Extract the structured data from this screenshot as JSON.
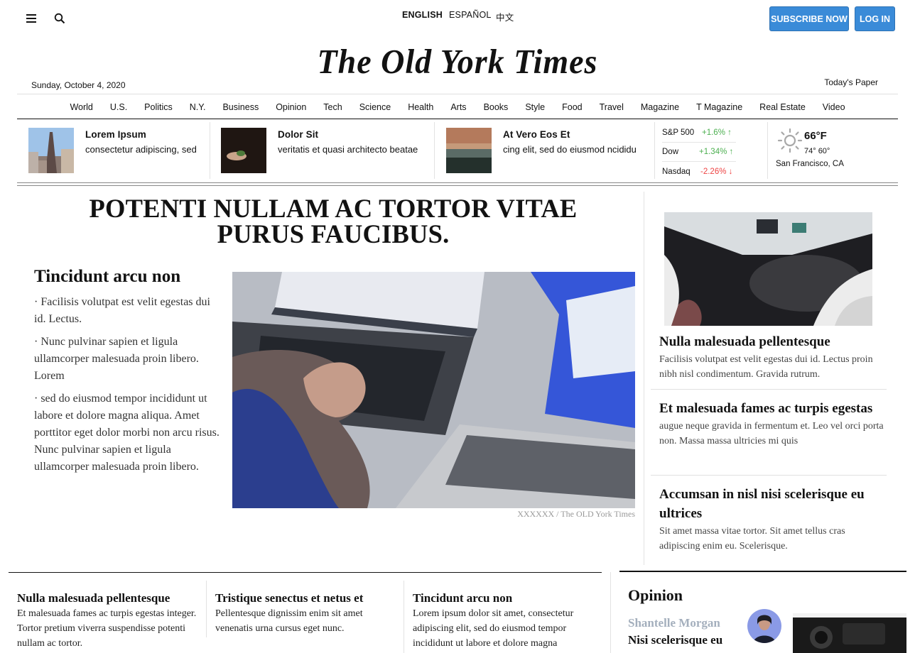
{
  "topbar": {
    "languages": [
      "ENGLISH",
      "ESPAÑOL",
      "中文"
    ],
    "subscribe_label": "SUBSCRIBE NOW",
    "login_label": "LOG IN"
  },
  "masthead": {
    "title": "The Old York Times",
    "date": "Sunday, October 4, 2020",
    "todays_paper": "Today's Paper"
  },
  "nav": [
    "World",
    "U.S.",
    "Politics",
    "N.Y.",
    "Business",
    "Opinion",
    "Tech",
    "Science",
    "Health",
    "Arts",
    "Books",
    "Style",
    "Food",
    "Travel",
    "Magazine",
    "T Magazine",
    "Real Estate",
    "Video"
  ],
  "briefing": [
    {
      "title": "Lorem Ipsum",
      "summary": "consectetur adipiscing, sed"
    },
    {
      "title": "Dolor Sit",
      "summary": "veritatis et quasi architecto beatae"
    },
    {
      "title": "At Vero Eos Et",
      "summary": "cing elit, sed do eiusmod ncididu"
    }
  ],
  "markets": [
    {
      "name": "S&P 500",
      "change": "+1.6%",
      "arrow": "↑",
      "direction": "up"
    },
    {
      "name": "Dow",
      "change": "+1.34%",
      "arrow": "↑",
      "direction": "up"
    },
    {
      "name": "Nasdaq",
      "change": "-2.26%",
      "arrow": "↓",
      "direction": "down"
    }
  ],
  "weather": {
    "temp": "66°F",
    "hilo": "74° 60°",
    "city": "San Francisco, CA"
  },
  "main": {
    "headline_line1": "POTENTI NULLAM AC TORTOR VITAE",
    "headline_line2": "PURUS FAUCIBUS.",
    "subheadline": "Tincidunt arcu non",
    "bullets": [
      "· Facilisis volutpat est velit egestas dui id. Lectus.",
      "· Nunc pulvinar sapien et ligula ullamcorper malesuada proin libero. Lorem",
      "· sed do eiusmod tempor incididunt ut labore et dolore magna aliqua. Amet porttitor eget dolor morbi non arcu risus. Nunc pulvinar sapien et ligula ullamcorper malesuada proin libero."
    ],
    "caption": "XXXXXX / The OLD York Times"
  },
  "right_column": [
    {
      "headline": "Nulla malesuada pellentesque",
      "summary": "Facilisis volutpat est velit egestas dui id. Lectus proin nibh nisl condimentum. Gravida rutrum."
    },
    {
      "headline": "Et malesuada fames ac turpis egestas",
      "summary": "augue neque gravida in fermentum et. Leo vel orci porta non. Massa massa ultricies mi quis"
    },
    {
      "headline": "Accumsan in nisl nisi scelerisque eu ultrices",
      "summary": "Sit amet massa vitae tortor. Sit amet tellus cras adipiscing enim eu. Scelerisque."
    }
  ],
  "bottom_stories": [
    {
      "headline": "Nulla malesuada pellentesque",
      "summary": "Et malesuada fames ac turpis egestas integer. Tortor pretium viverra suspendisse potenti nullam ac tortor."
    },
    {
      "headline": "Tristique senectus et netus et",
      "summary": "Pellentesque dignissim enim sit amet venenatis urna cursus eget nunc."
    },
    {
      "headline": "Tincidunt arcu non",
      "summary": "Lorem ipsum dolor sit amet, consectetur adipiscing elit, sed do eiusmod tempor incididunt ut labore et dolore magna"
    }
  ],
  "opinion": {
    "section_title": "Opinion",
    "author": "Shantelle Morgan",
    "title": "Nisi scelerisque eu"
  },
  "colors": {
    "button_blue": "#3a8bd8",
    "market_up": "#4caf50",
    "market_down": "#ee4444",
    "author_gray": "#a4afbd"
  }
}
